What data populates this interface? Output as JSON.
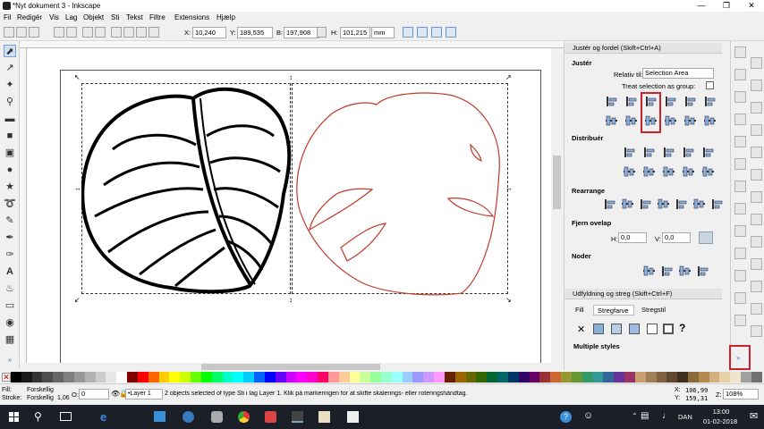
{
  "window": {
    "title": "*Nyt dokument 3 - Inkscape"
  },
  "menu": [
    "Fil",
    "Redigér",
    "Vis",
    "Lag",
    "Objekt",
    "Sti",
    "Tekst",
    "Filtre",
    "Extensions",
    "Hjælp"
  ],
  "toolbar": {
    "x_label": "X:",
    "x_value": "10,240",
    "y_label": "Y:",
    "y_value": "189,535",
    "w_label": "B:",
    "w_value": "197,908",
    "h_label": "H:",
    "h_value": "101,215",
    "unit": "mm"
  },
  "panel_align": {
    "title": "Justér og fordel (Skift+Ctrl+A)",
    "section_align": "Justér",
    "relative_label": "Relativ til:",
    "relative_value": "Selection Area",
    "treat_group_label": "Treat selection as group:",
    "section_distribute": "Distribuér",
    "section_rearrange": "Rearrange",
    "section_overlap": "Fjern ovelap",
    "h_label": "H:",
    "h_value": "0,0",
    "v_label": "V:",
    "v_value": "0,0",
    "section_nodes": "Noder"
  },
  "panel_fill": {
    "title": "Udfyldning og streg (Skift+Ctrl+F)",
    "tab_fill": "Fill",
    "tab_stroke_paint": "Stregfarve",
    "tab_stroke_style": "Stregstil",
    "unknown_glyph": "?",
    "multiple": "Multiple styles"
  },
  "status": {
    "fill_label": "Fill:",
    "fill_value": "Forskellig",
    "stroke_label": "Stroke:",
    "stroke_value": "Forskellig",
    "stroke_width": "1,06",
    "opacity_label": "O:",
    "opacity_value": "0",
    "layer": "•Layer 1",
    "message": "2 objects selected of type Sti i lag Layer 1. Klik på markeringen for at skifte skalerings- eller roteringshåndtag.",
    "coord_x_label": "X:",
    "coord_x": "106,99",
    "coord_y_label": "Y:",
    "coord_y": "159,31",
    "zoom_label": "Z:",
    "zoom": "108%"
  },
  "taskbar": {
    "lang": "DAN",
    "time": "13:00",
    "date": "01-02-2018"
  },
  "colors": {
    "accent": "#4a7ab8",
    "highlight": "#d0202a",
    "leaf_outline": "#c0392b"
  },
  "palette": [
    "#000000",
    "#1a1a1a",
    "#333333",
    "#4d4d4d",
    "#666666",
    "#808080",
    "#999999",
    "#b3b3b3",
    "#cccccc",
    "#e6e6e6",
    "#ffffff",
    "#800000",
    "#ff0000",
    "#ff6600",
    "#ffcc00",
    "#ffff00",
    "#ccff00",
    "#66ff00",
    "#00ff00",
    "#00ff66",
    "#00ffcc",
    "#00ffff",
    "#00ccff",
    "#0066ff",
    "#0000ff",
    "#6600ff",
    "#cc00ff",
    "#ff00ff",
    "#ff00cc",
    "#ff0066",
    "#ff9999",
    "#ffcc99",
    "#ffff99",
    "#ccff99",
    "#99ff99",
    "#99ffcc",
    "#99ffff",
    "#99ccff",
    "#9999ff",
    "#cc99ff",
    "#ff99ff",
    "#662200",
    "#996600",
    "#666600",
    "#336600",
    "#006633",
    "#006666",
    "#003366",
    "#330066",
    "#660066",
    "#993333",
    "#cc6633",
    "#999933",
    "#669933",
    "#339966",
    "#339999",
    "#336699",
    "#663399",
    "#993366",
    "#c8a070",
    "#a0805a",
    "#806040",
    "#604830",
    "#403020",
    "#8a6a3a",
    "#b48a50",
    "#d4b080",
    "#e8d0a8",
    "#f0e4cc",
    "#a0a0a0",
    "#707070"
  ]
}
